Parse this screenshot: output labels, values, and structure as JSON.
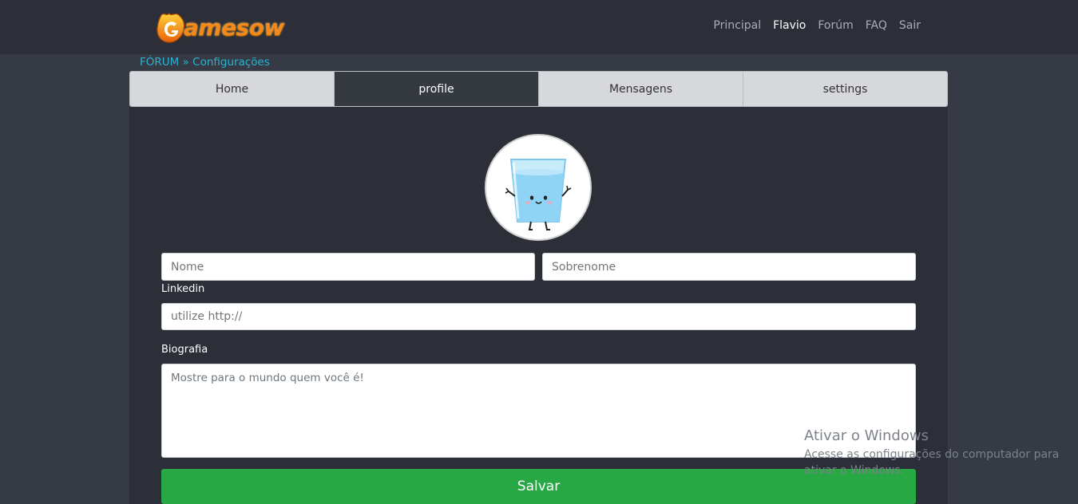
{
  "header": {
    "logo_text": "amesow",
    "nav": [
      {
        "label": "Principal",
        "active": false
      },
      {
        "label": "Flavio",
        "active": true
      },
      {
        "label": "Forúm",
        "active": false
      },
      {
        "label": "FAQ",
        "active": false
      },
      {
        "label": "Sair",
        "active": false
      }
    ]
  },
  "breadcrumb": "FÓRUM » Configurações",
  "tabs": [
    {
      "label": "Home",
      "active": false
    },
    {
      "label": "profile",
      "active": true
    },
    {
      "label": "Mensagens",
      "active": false
    },
    {
      "label": "settings",
      "active": false
    }
  ],
  "form": {
    "first_name_placeholder": "Nome",
    "last_name_placeholder": "Sobrenome",
    "linkedin_label": "Linkedin",
    "linkedin_placeholder": "utilize http://",
    "bio_label": "Biografia",
    "bio_placeholder": "Mostre para o mundo quem você é!",
    "save_label": "Salvar"
  },
  "watermark": {
    "title": "Ativar o Windows",
    "line1": "Acesse as configurações do computador para",
    "line2": "ativar o Windows."
  },
  "colors": {
    "page_bg": "#363a45",
    "navbar_bg": "#2c2f38",
    "accent_link": "#29b3d1",
    "save_button": "#28a745",
    "logo": "#f08a1c"
  }
}
